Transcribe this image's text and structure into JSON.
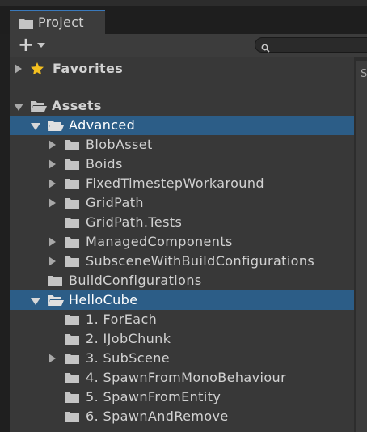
{
  "tab": {
    "title": "Project",
    "icon": "folder-icon"
  },
  "toolbar": {
    "add_label": "+",
    "search_placeholder": ""
  },
  "right_panel": {
    "letter": "S"
  },
  "tree": {
    "favorites": {
      "label": "Favorites",
      "icon": "star-icon"
    },
    "assets": {
      "label": "Assets",
      "icon": "open-folder-icon"
    },
    "items": [
      {
        "label": "Advanced",
        "icon": "open-folder-icon",
        "expanded": true,
        "selected": true
      },
      {
        "label": "BlobAsset",
        "icon": "folder-icon"
      },
      {
        "label": "Boids",
        "icon": "folder-icon"
      },
      {
        "label": "FixedTimestepWorkaround",
        "icon": "folder-icon"
      },
      {
        "label": "GridPath",
        "icon": "folder-icon"
      },
      {
        "label": "GridPath.Tests",
        "icon": "folder-icon"
      },
      {
        "label": "ManagedComponents",
        "icon": "folder-icon"
      },
      {
        "label": "SubsceneWithBuildConfigurations",
        "icon": "folder-icon"
      },
      {
        "label": "BuildConfigurations",
        "icon": "folder-icon"
      },
      {
        "label": "HelloCube",
        "icon": "open-folder-icon",
        "expanded": true,
        "selected": true
      },
      {
        "label": "1. ForEach",
        "icon": "folder-icon"
      },
      {
        "label": "2. IJobChunk",
        "icon": "folder-icon"
      },
      {
        "label": "3. SubScene",
        "icon": "folder-icon"
      },
      {
        "label": "4. SpawnFromMonoBehaviour",
        "icon": "folder-icon"
      },
      {
        "label": "5. SpawnFromEntity",
        "icon": "folder-icon"
      },
      {
        "label": "6. SpawnAndRemove",
        "icon": "folder-icon"
      }
    ]
  },
  "colors": {
    "selection": "#2c5d87",
    "tab_accent": "#3a79bb",
    "panel": "#383838",
    "star": "#f4c020"
  }
}
